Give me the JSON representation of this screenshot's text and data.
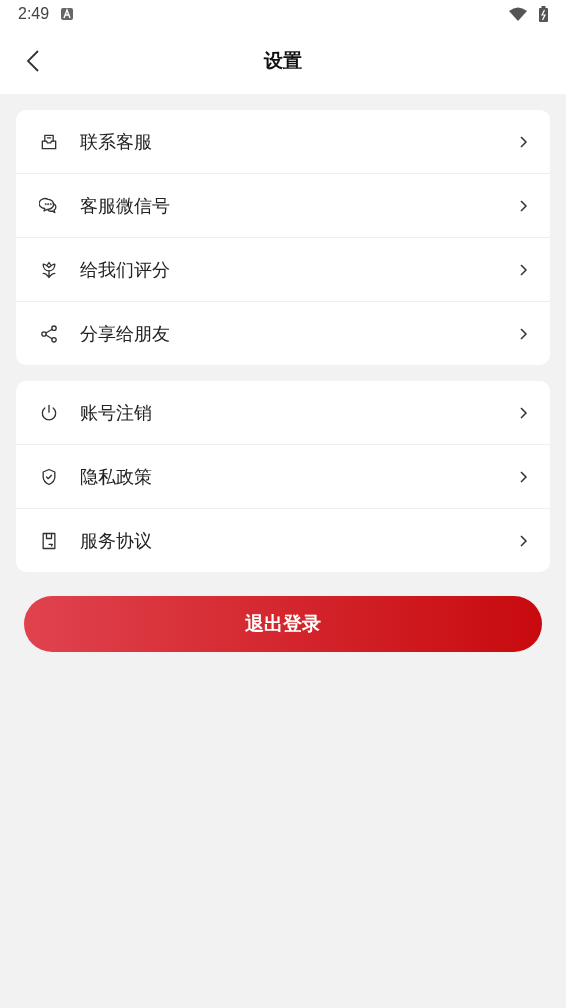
{
  "status_bar": {
    "time": "2:49"
  },
  "header": {
    "title": "设置"
  },
  "groups": [
    {
      "items": [
        {
          "label": "联系客服"
        },
        {
          "label": "客服微信号"
        },
        {
          "label": "给我们评分"
        },
        {
          "label": "分享给朋友"
        }
      ]
    },
    {
      "items": [
        {
          "label": "账号注销"
        },
        {
          "label": "隐私政策"
        },
        {
          "label": "服务协议"
        }
      ]
    }
  ],
  "logout_button": {
    "label": "退出登录"
  }
}
